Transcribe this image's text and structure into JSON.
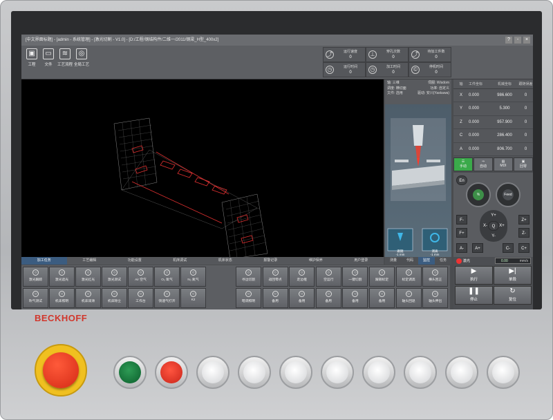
{
  "window": {
    "title": "[中文界面标题] - [admin - 系统管理] - [激光切割 - V1.0] - [D:/工程/钢结构件/二维一/2011/钢梁_H型_400x2]",
    "btns": [
      "?",
      "-",
      "×"
    ]
  },
  "toolbar": {
    "buttons": [
      {
        "label": "工程",
        "icon": "new-file-icon"
      },
      {
        "label": "文件",
        "icon": "folder-icon"
      },
      {
        "label": "工艺流程",
        "icon": "process-icon"
      },
      {
        "label": "全局工艺",
        "icon": "global-icon"
      }
    ]
  },
  "status": [
    {
      "label": "运行速度",
      "value": "0"
    },
    {
      "label": "穿孔次数",
      "value": "0"
    },
    {
      "label": "待加工件数",
      "value": "0"
    },
    {
      "label": "运行时间",
      "value": "0"
    },
    {
      "label": "加工时间",
      "value": "0"
    },
    {
      "label": "停机时间",
      "value": "0"
    }
  ],
  "info": {
    "r1a": "轴: 三维",
    "r1b": "伺服: Wisdom",
    "r2a": "调度: 横切面",
    "r2b": "功率: 自定义",
    "r3a": "文件: 选用",
    "r3b": "驱动: 安川(Yaskawa)"
  },
  "coords": {
    "header": [
      "轴",
      "工件坐标",
      "机械坐标",
      "跟随误差"
    ],
    "rows": [
      {
        "axis": "X",
        "work": "0.000",
        "mach": "986.600",
        "err": "0"
      },
      {
        "axis": "Y",
        "work": "0.000",
        "mach": "5.300",
        "err": "0"
      },
      {
        "axis": "Z",
        "work": "0.000",
        "mach": "957.900",
        "err": "0"
      },
      {
        "axis": "C",
        "work": "0.000",
        "mach": "286.400",
        "err": "0"
      },
      {
        "axis": "A",
        "work": "0.000",
        "mach": "806.700",
        "err": "0"
      }
    ]
  },
  "modes": [
    "手动",
    "自动",
    "MDI",
    "回零"
  ],
  "jog": {
    "en": "En",
    "keys": [
      "F-",
      "F+",
      "Z+",
      "Z-",
      "A-",
      "A+",
      "C-",
      "C+",
      "Y+",
      "X-",
      "X+",
      "Y-",
      "Q"
    ],
    "knob1": "%",
    "knob2": "Feed"
  },
  "tabs": [
    "加工任务",
    "工艺编辑",
    "功能设置",
    "机床调试",
    "机床状态",
    "报警记录",
    "维护保养",
    "用户登录"
  ],
  "right_tabs": [
    "测量",
    "代码",
    "监控",
    "任务"
  ],
  "anim_labels": {
    "left": "跟随",
    "left_val": "-1 mm",
    "right": "测高",
    "right_val": "-1 mm"
  },
  "buttons": [
    [
      "激光跟踪",
      "激光遮光",
      "激光红光",
      "激光测试",
      "Air 空气",
      "O₂ 氧气",
      "N₂ 氮气"
    ],
    [
      "吹气测试",
      "机床照明",
      "机床润滑",
      "机床除尘",
      "工作台",
      "快速气打开",
      "K2"
    ],
    [
      "寻边切割",
      "返回零点",
      "走边框",
      "空运行",
      "一键切割",
      "跟随标定",
      "标定调高",
      "横头回正"
    ],
    [
      "暗调照明",
      "备用",
      "备用",
      "备用",
      "备用",
      "备用",
      "轴头回退",
      "轴头伸出"
    ]
  ],
  "ctrl": {
    "laser": "激光",
    "speed": "0.00",
    "unit": "mm/s",
    "buttons": [
      "执行",
      "单段",
      "停止",
      "复位"
    ]
  },
  "brand": "BECKHOFF"
}
